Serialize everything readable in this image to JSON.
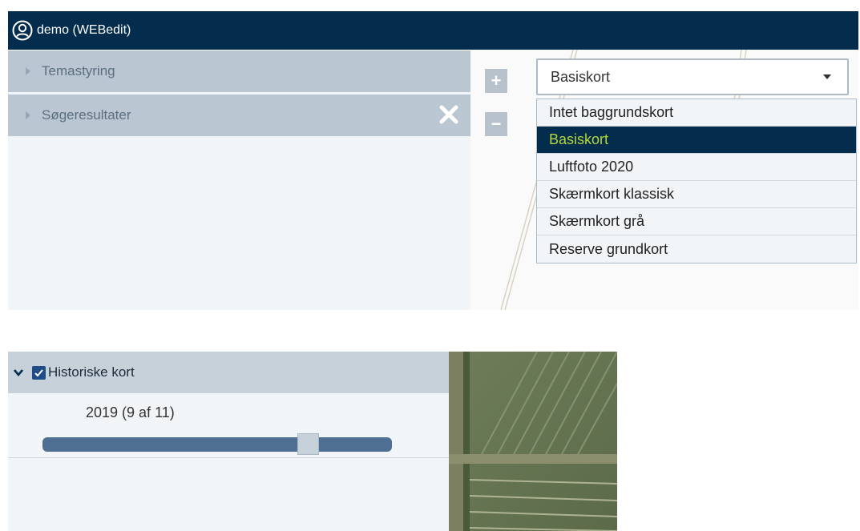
{
  "header": {
    "user_label": "demo (WEBedit)"
  },
  "panel": {
    "accordions": [
      {
        "label": "Temastyring"
      },
      {
        "label": "Søgeresultater"
      }
    ]
  },
  "zoom": {
    "in_symbol": "+",
    "out_symbol": "−"
  },
  "basemap": {
    "selected": "Basiskort",
    "options": [
      "Intet baggrundskort",
      "Basiskort",
      "Luftfoto 2020",
      "Skærmkort klassisk",
      "Skærmkort grå",
      "Reserve grundkort"
    ]
  },
  "historical": {
    "title": "Historiske kort",
    "checked": true,
    "year_label": "2019 (9 af 11)",
    "slider_index": 9,
    "slider_total": 11
  },
  "colors": {
    "header_bg": "#032c4d",
    "selected_text": "#b6d63a",
    "checkbox": "#1f4b86"
  }
}
